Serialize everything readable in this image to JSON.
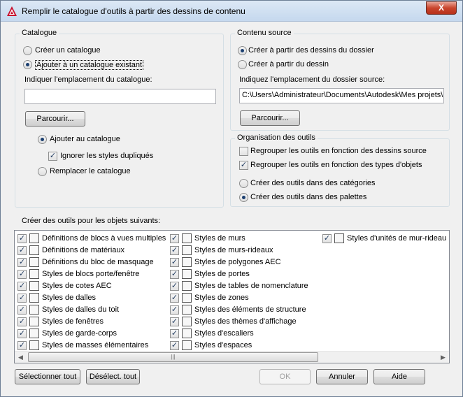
{
  "window": {
    "title": "Remplir le catalogue d'outils à partir des dessins de contenu",
    "close_label": "X"
  },
  "catalogue": {
    "group_title": "Catalogue",
    "create_label": "Créer un catalogue",
    "add_existing_label": "Ajouter à un catalogue existant",
    "location_label": "Indiquer l'emplacement du catalogue:",
    "location_value": "",
    "browse_label": "Parcourir...",
    "add_to_label": "Ajouter au catalogue",
    "ignore_dup_label": "Ignorer les styles dupliqués",
    "replace_label": "Remplacer le catalogue"
  },
  "source": {
    "group_title": "Contenu source",
    "from_folder_label": "Créer à partir des dessins du dossier",
    "from_drawing_label": "Créer à partir du dessin",
    "folder_label": "Indiquez l'emplacement du dossier source:",
    "folder_value": "C:\\Users\\Administrateur\\Documents\\Autodesk\\Mes projets\\",
    "browse_label": "Parcourir..."
  },
  "organisation": {
    "group_title": "Organisation des outils",
    "group_by_drawing_label": "Regrouper les outils en fonction des dessins source",
    "group_by_type_label": "Regrouper les outils en fonction des types d'objets",
    "in_categories_label": "Créer des outils dans des catégories",
    "in_palettes_label": "Créer des outils dans des palettes"
  },
  "objects": {
    "label": "Créer des outils pour les objets suivants:",
    "col1": [
      {
        "label": "Définitions de blocs à vues multiples",
        "icon": "multiview-block-icon"
      },
      {
        "label": "Définitions de matériaux",
        "icon": "material-icon"
      },
      {
        "label": "Définitions du bloc de masquage",
        "icon": "mask-block-icon"
      },
      {
        "label": "Styles de blocs porte/fenêtre",
        "icon": "door-window-block-icon"
      },
      {
        "label": "Styles de cotes AEC",
        "icon": "dimension-icon"
      },
      {
        "label": "Styles de dalles",
        "icon": "slab-icon"
      },
      {
        "label": "Styles de dalles du toit",
        "icon": "roof-slab-icon"
      },
      {
        "label": "Styles de fenêtres",
        "icon": "window-icon"
      },
      {
        "label": "Styles de garde-corps",
        "icon": "railing-icon"
      },
      {
        "label": "Styles de masses élémentaires",
        "icon": "mass-element-icon"
      }
    ],
    "col2": [
      {
        "label": "Styles de murs",
        "icon": "wall-icon"
      },
      {
        "label": "Styles de murs-rideaux",
        "icon": "curtain-wall-icon"
      },
      {
        "label": "Styles de polygones AEC",
        "icon": "polygon-icon"
      },
      {
        "label": "Styles de portes",
        "icon": "door-icon"
      },
      {
        "label": "Styles de tables de nomenclature",
        "icon": "schedule-table-icon"
      },
      {
        "label": "Styles de zones",
        "icon": "zone-icon"
      },
      {
        "label": "Styles des éléments de structure",
        "icon": "structural-member-icon"
      },
      {
        "label": "Styles des thèmes d'affichage",
        "icon": "display-theme-icon"
      },
      {
        "label": "Styles d'escaliers",
        "icon": "stair-icon"
      },
      {
        "label": "Styles d'espaces",
        "icon": "space-icon"
      }
    ],
    "col3": [
      {
        "label": "Styles d'unités de mur-rideau",
        "icon": "curtain-wall-unit-icon"
      }
    ]
  },
  "buttons": {
    "select_all": "Sélectionner tout",
    "deselect_all": "Désélect. tout",
    "ok": "OK",
    "cancel": "Annuler",
    "help": "Aide"
  }
}
